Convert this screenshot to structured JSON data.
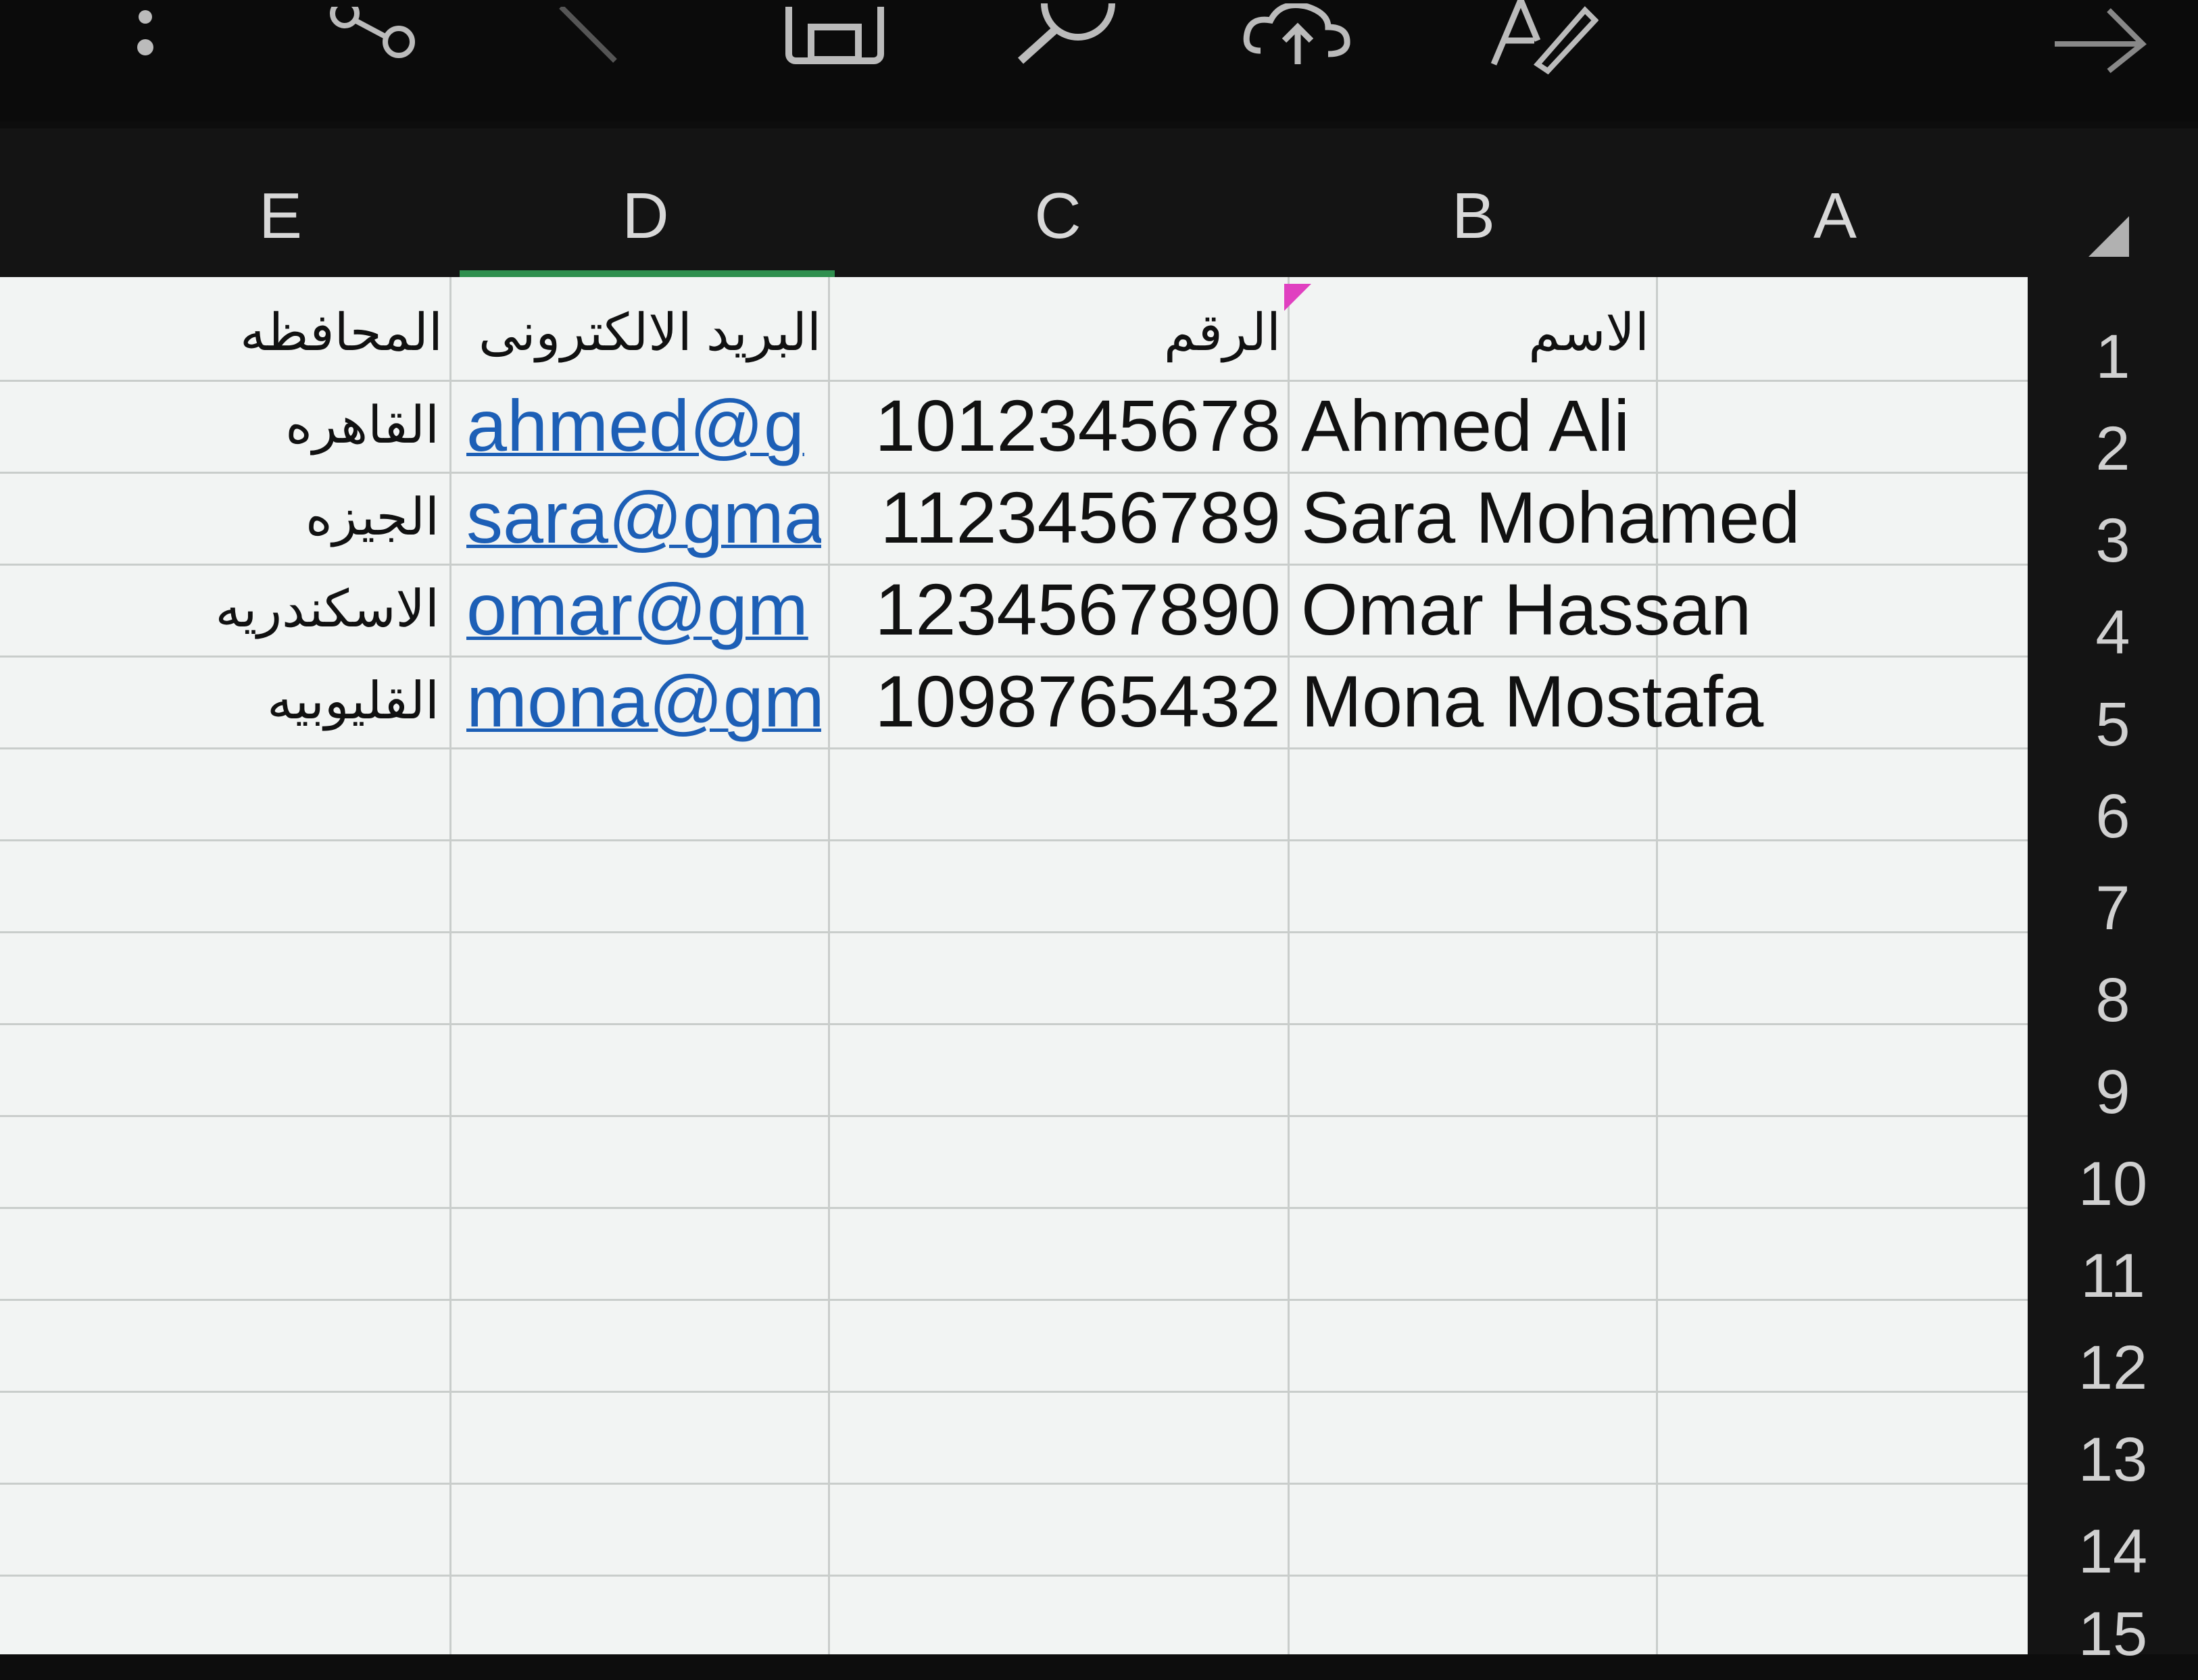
{
  "toolbar": {
    "icons": [
      "more-icon",
      "share-icon",
      "pen-icon",
      "save-icon",
      "search-icon",
      "cloud-upload-icon",
      "text-format-icon",
      "forward-arrow-icon"
    ]
  },
  "columns": [
    "E",
    "D",
    "C",
    "B",
    "A"
  ],
  "rows": [
    "1",
    "2",
    "3",
    "4",
    "5",
    "6",
    "7",
    "8",
    "9",
    "10",
    "11",
    "12",
    "13",
    "14",
    "15"
  ],
  "sheet": {
    "headers": {
      "name": "الاسم",
      "number": "الرقم",
      "email": "البريد الالكترونى",
      "governorate": "المحافظه"
    },
    "data": [
      {
        "name": "Ahmed Ali",
        "number": "1012345678",
        "email": "ahmed@g",
        "governorate": "القاهره"
      },
      {
        "name": "Sara Mohamed",
        "number": "1123456789",
        "email": "sara@gma",
        "governorate": "الجيزه"
      },
      {
        "name": "Omar Hassan",
        "number": "1234567890",
        "email": "omar@gm",
        "governorate": "الاسكندريه"
      },
      {
        "name": "Mona Mostafa",
        "number": "1098765432",
        "email": "mona@gm",
        "governorate": "القليوبيه"
      }
    ]
  },
  "colors": {
    "link": "#1d5fb6",
    "selection": "#2f8f4e",
    "comment": "#e040c0"
  }
}
